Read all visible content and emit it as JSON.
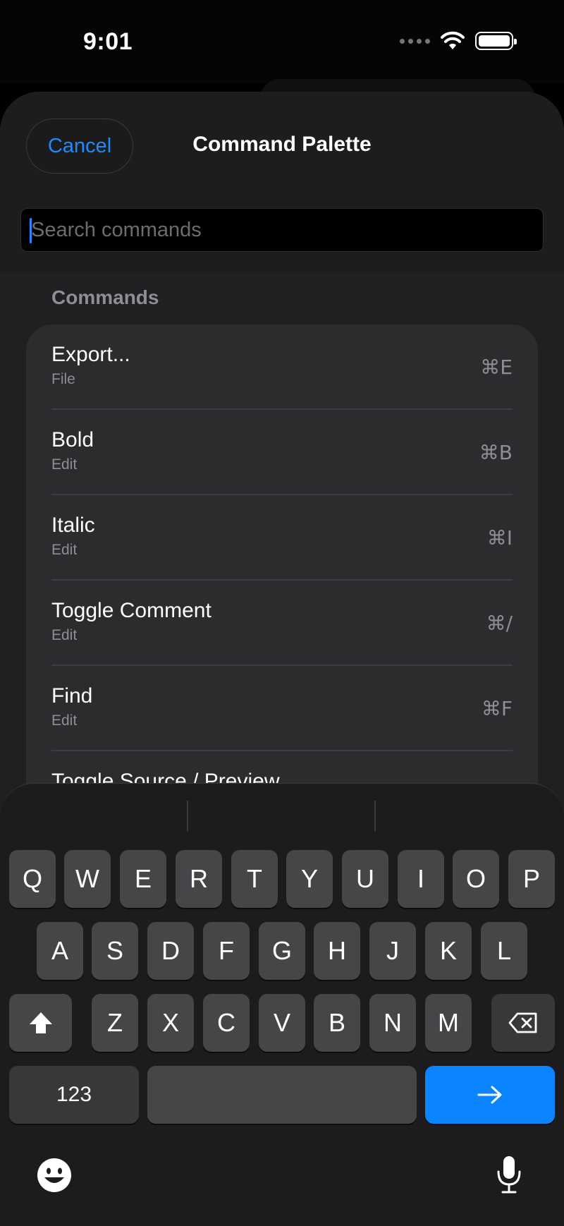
{
  "status_bar": {
    "time": "9:01",
    "icons": [
      "cellular-dots-icon",
      "wifi-icon",
      "battery-icon"
    ]
  },
  "sheet": {
    "cancel_label": "Cancel",
    "title": "Command Palette",
    "search_placeholder": "Search commands",
    "search_value": ""
  },
  "section": {
    "label": "Commands"
  },
  "commands": [
    {
      "title": "Export...",
      "category": "File",
      "shortcut": "⌘E"
    },
    {
      "title": "Bold",
      "category": "Edit",
      "shortcut": "⌘B"
    },
    {
      "title": "Italic",
      "category": "Edit",
      "shortcut": "⌘I"
    },
    {
      "title": "Toggle Comment",
      "category": "Edit",
      "shortcut": "⌘/"
    },
    {
      "title": "Find",
      "category": "Edit",
      "shortcut": "⌘F"
    },
    {
      "title": "Toggle Source / Preview",
      "category": "",
      "shortcut": ""
    }
  ],
  "keyboard": {
    "row1": [
      "Q",
      "W",
      "E",
      "R",
      "T",
      "Y",
      "U",
      "I",
      "O",
      "P"
    ],
    "row2": [
      "A",
      "S",
      "D",
      "F",
      "G",
      "H",
      "J",
      "K",
      "L"
    ],
    "row3": [
      "Z",
      "X",
      "C",
      "V",
      "B",
      "N",
      "M"
    ],
    "numbers_label": "123",
    "go_icon": "arrow-right-icon",
    "shift_icon": "shift-icon",
    "delete_icon": "delete-backward-icon",
    "emoji_icon": "emoji-icon",
    "mic_icon": "microphone-icon",
    "accent_color": "#0a84ff"
  }
}
